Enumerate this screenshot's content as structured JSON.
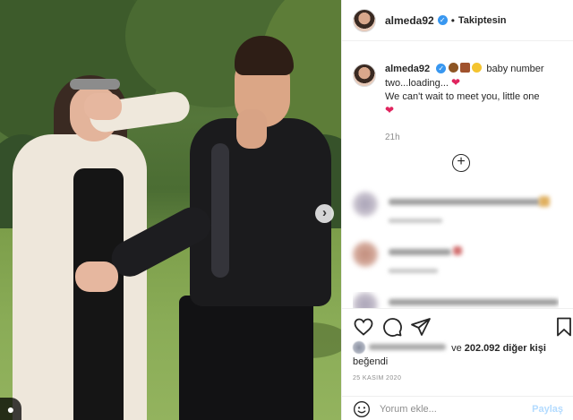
{
  "post": {
    "username": "almeda92",
    "follow_status": "Takiptesin",
    "header_dot": "•",
    "photo_next_button": "›",
    "watermark_glyph": "●"
  },
  "caption": {
    "username": "almeda92",
    "text_line1": "baby number two...loading...",
    "text_line2": "We can't wait to meet you, little one",
    "heart": "❤",
    "time_ago": "21h",
    "emoji_colors": [
      "#8d5524",
      "#a0522d",
      "#f4c430"
    ]
  },
  "comments": {
    "load_more_glyph": "+"
  },
  "likes": {
    "text_prefix": "ve",
    "count": "202.092",
    "text_suffix": "diğer kişi",
    "liked_word": "beğendi"
  },
  "date": "25 KASIM 2020",
  "comment_box": {
    "placeholder": "Yorum ekle...",
    "share_label": "Paylaş"
  },
  "colors": {
    "accent_blue": "#3897f0",
    "share_disabled": "#b3dbff",
    "heart_red": "#e0245e"
  },
  "icons": [
    "heart-icon",
    "comment-icon",
    "share-icon",
    "bookmark-icon",
    "emoji-icon",
    "verified-icon",
    "plus-circle-icon",
    "chevron-right-icon"
  ]
}
